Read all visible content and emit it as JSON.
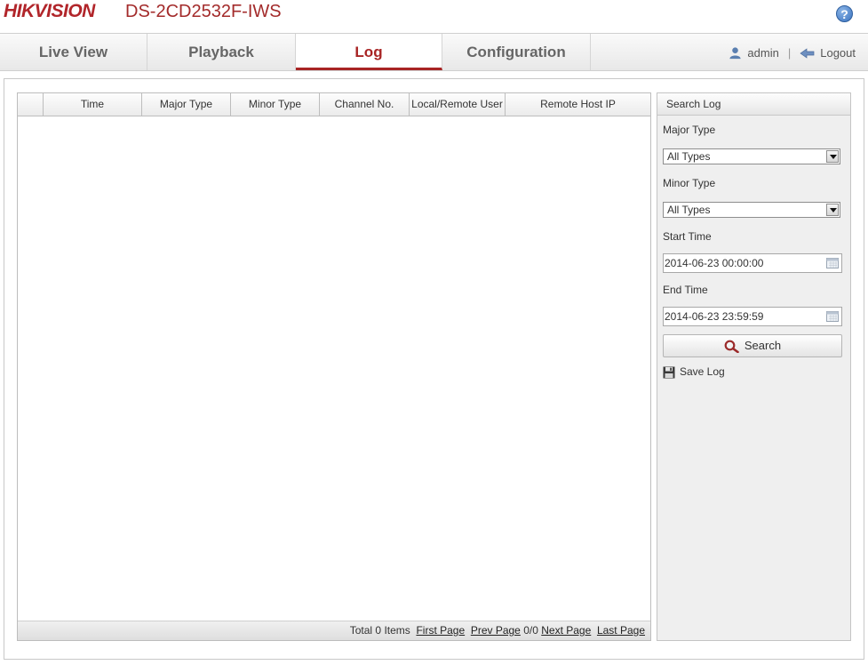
{
  "header": {
    "logo": "HIKVISION",
    "model": "DS-2CD2532F-IWS",
    "help_symbol": "?"
  },
  "nav": {
    "tabs": [
      {
        "label": "Live View",
        "active": false
      },
      {
        "label": "Playback",
        "active": false
      },
      {
        "label": "Log",
        "active": true
      },
      {
        "label": "Configuration",
        "active": false
      }
    ],
    "user": "admin",
    "separator": "|",
    "logout": "Logout"
  },
  "table": {
    "columns": [
      "",
      "Time",
      "Major Type",
      "Minor Type",
      "Channel No.",
      "Local/Remote User",
      "Remote Host IP"
    ],
    "rows": []
  },
  "pager": {
    "total": "Total 0 Items",
    "first": "First Page",
    "prev": "Prev Page",
    "page": "0/0",
    "next": "Next Page",
    "last": "Last Page"
  },
  "search": {
    "title": "Search Log",
    "major_type_label": "Major Type",
    "major_type_value": "All Types",
    "minor_type_label": "Minor Type",
    "minor_type_value": "All Types",
    "start_time_label": "Start Time",
    "start_time_value": "2014-06-23 00:00:00",
    "end_time_label": "End Time",
    "end_time_value": "2014-06-23 23:59:59",
    "search_button": "Search",
    "save_log": "Save Log"
  },
  "colors": {
    "brand": "#b1252a",
    "active_tab": "#a82424"
  }
}
